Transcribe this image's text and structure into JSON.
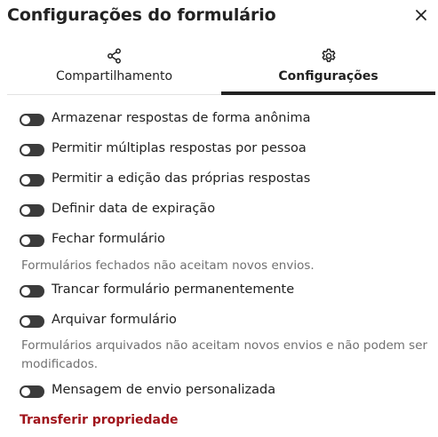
{
  "header": {
    "title": "Configurações do formulário",
    "close_icon": "close-icon"
  },
  "tabs": [
    {
      "label": "Compartilhamento",
      "icon": "share-icon",
      "active": false
    },
    {
      "label": "Configurações",
      "icon": "gear-icon",
      "active": true
    }
  ],
  "settings": [
    {
      "label": "Armazenar respostas de forma anônima",
      "enabled": false
    },
    {
      "label": "Permitir múltiplas respostas por pessoa",
      "enabled": false
    },
    {
      "label": "Permitir a edição das próprias respostas",
      "enabled": false
    },
    {
      "label": "Definir data de expiração",
      "enabled": false
    },
    {
      "label": "Fechar formulário",
      "enabled": false
    },
    {
      "label": "Trancar formulário permanentemente",
      "enabled": false
    },
    {
      "label": "Arquivar formulário",
      "enabled": false
    },
    {
      "label": "Mensagem de envio personalizada",
      "enabled": false
    }
  ],
  "notes": {
    "closed": "Formulários fechados não aceitam novos envios.",
    "archived": "Formulários arquivados não aceitam novos envios e não podem ser modificados."
  },
  "transfer_label": "Transferir propriedade",
  "colors": {
    "toggle_off": "#3b3b3b",
    "danger": "#a0141b",
    "muted": "#707070"
  }
}
